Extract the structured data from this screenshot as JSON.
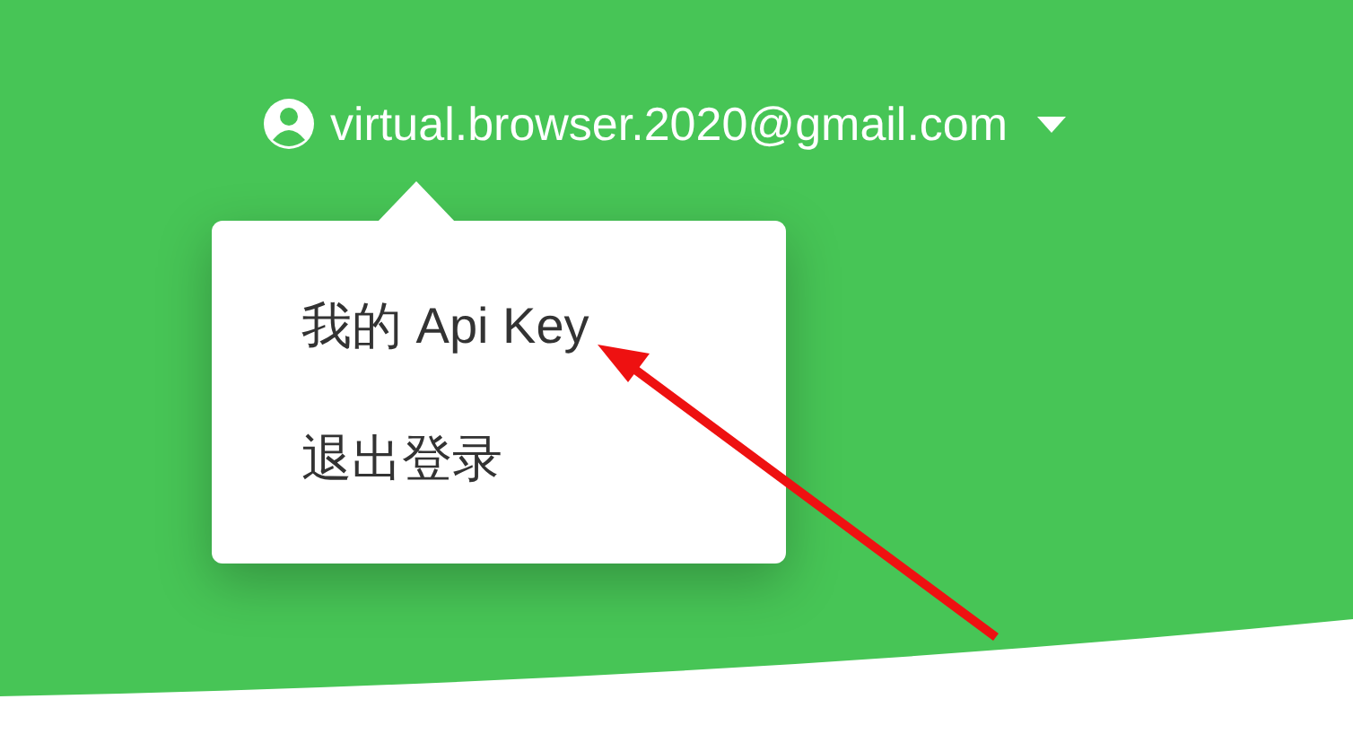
{
  "account": {
    "email": "virtual.browser.2020@gmail.com"
  },
  "menu": {
    "items": [
      {
        "label": "我的 Api Key"
      },
      {
        "label": "退出登录"
      }
    ]
  }
}
